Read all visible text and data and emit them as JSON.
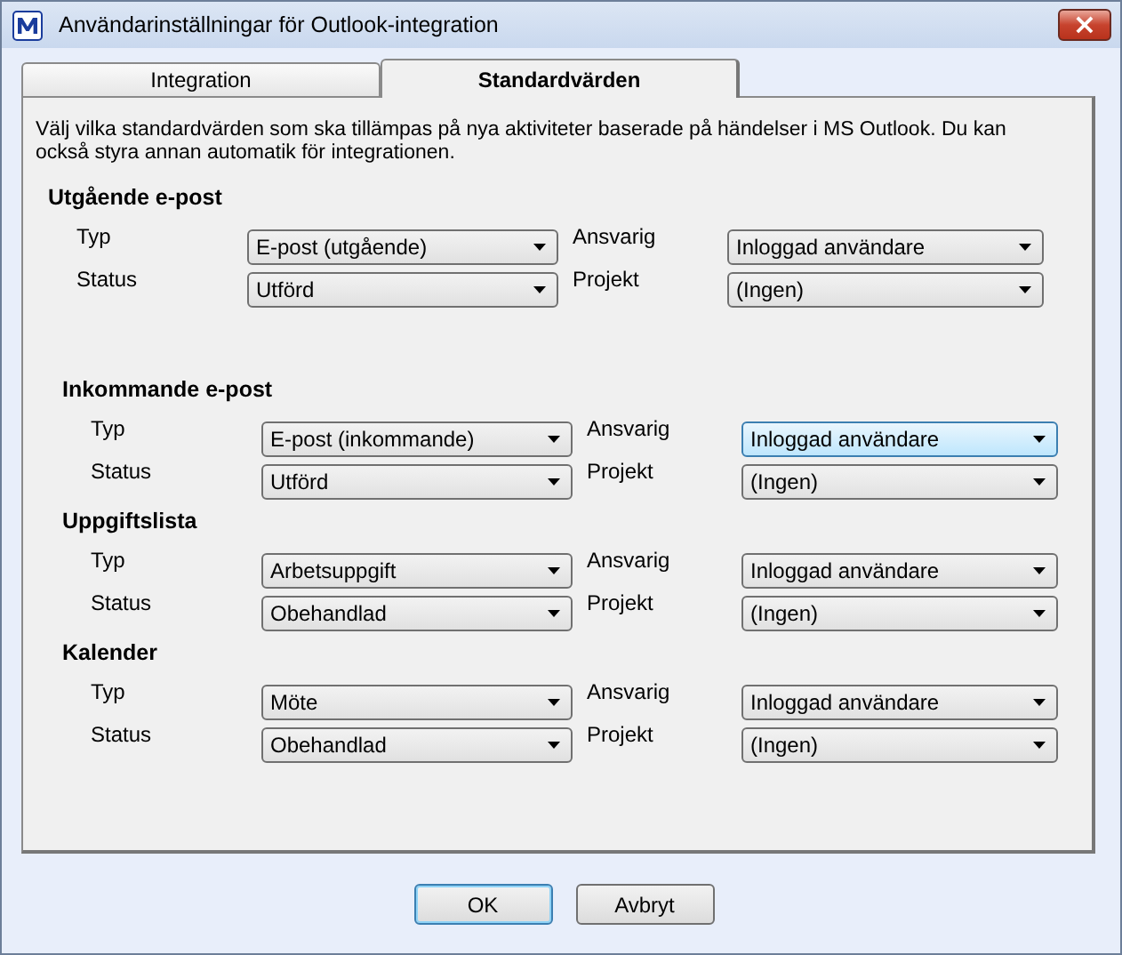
{
  "window": {
    "title": "Användarinställningar för Outlook-integration",
    "close": "×"
  },
  "tabs": [
    {
      "label": "Integration",
      "selected": false
    },
    {
      "label": "Standardvärden",
      "selected": true
    }
  ],
  "description": "Välj vilka standardvärden som ska tillämpas på nya aktiviteter baserade på händelser i MS Outlook. Du kan också styra annan automatik för integrationen.",
  "sections": [
    {
      "title": "Utgående e-post",
      "fields": [
        {
          "label": "Typ",
          "value": "E-post (utgående)",
          "hot": false
        },
        {
          "label": "Ansvarig",
          "value": "Inloggad användare",
          "hot": false
        },
        {
          "label": "Status",
          "value": "Utförd",
          "hot": false
        },
        {
          "label": "Projekt",
          "value": "(Ingen)",
          "hot": false
        }
      ]
    },
    {
      "title": "Inkommande e-post",
      "fields": [
        {
          "label": "Typ",
          "value": "E-post (inkommande)",
          "hot": false
        },
        {
          "label": "Ansvarig",
          "value": "Inloggad användare",
          "hot": true
        },
        {
          "label": "Status",
          "value": "Utförd",
          "hot": false
        },
        {
          "label": "Projekt",
          "value": "(Ingen)",
          "hot": false
        }
      ]
    },
    {
      "title": "Uppgiftslista",
      "fields": [
        {
          "label": "Typ",
          "value": "Arbetsuppgift",
          "hot": false
        },
        {
          "label": "Ansvarig",
          "value": "Inloggad användare",
          "hot": false
        },
        {
          "label": "Status",
          "value": "Obehandlad",
          "hot": false
        },
        {
          "label": "Projekt",
          "value": "(Ingen)",
          "hot": false
        }
      ]
    },
    {
      "title": "Kalender",
      "fields": [
        {
          "label": "Typ",
          "value": "Möte",
          "hot": false
        },
        {
          "label": "Ansvarig",
          "value": "Inloggad användare",
          "hot": false
        },
        {
          "label": "Status",
          "value": "Obehandlad",
          "hot": false
        },
        {
          "label": "Projekt",
          "value": "(Ingen)",
          "hot": false
        }
      ]
    }
  ],
  "buttons": [
    {
      "label": "OK",
      "default": true
    },
    {
      "label": "Avbryt",
      "default": false
    }
  ]
}
